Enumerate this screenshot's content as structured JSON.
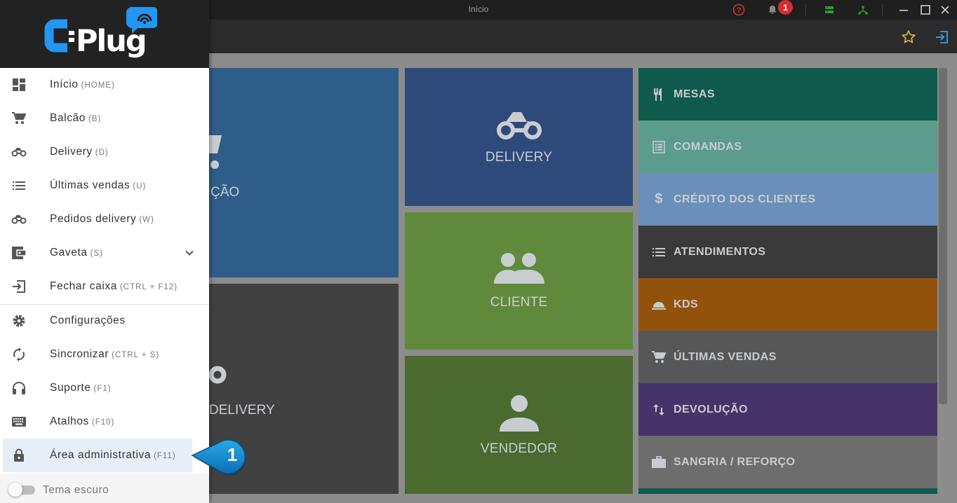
{
  "window": {
    "title": "Início",
    "notification_count": "1"
  },
  "tiles": {
    "balcao_partial": "ÇÃO",
    "delivery_partial": "DELIVERY",
    "delivery": "DELIVERY",
    "cliente": "CLIENTE",
    "vendedor": "VENDEDOR"
  },
  "side_menu": [
    {
      "label": "MESAS",
      "icon": "fork-knife-icon",
      "color": "#105a4d"
    },
    {
      "label": "COMANDAS",
      "icon": "list-box-icon",
      "color": "#5b9c8d"
    },
    {
      "label": "CRÉDITO DOS CLIENTES",
      "icon": "dollar-icon",
      "color": "#6890ba"
    },
    {
      "label": "ATENDIMENTOS",
      "icon": "list-icon",
      "color": "#3a3a3a"
    },
    {
      "label": "KDS",
      "icon": "cloche-icon",
      "color": "#92520c"
    },
    {
      "label": "ÚLTIMAS VENDAS",
      "icon": "cart-icon",
      "color": "#575757"
    },
    {
      "label": "DEVOLUÇÃO",
      "icon": "swap-vert-icon",
      "color": "#45336a"
    },
    {
      "label": "SANGRIA / REFORÇO",
      "icon": "briefcase-icon",
      "color": "#6d6d6d"
    }
  ],
  "logo": {
    "text": "CPlug"
  },
  "nav": [
    {
      "label": "Início",
      "key": "(HOME)",
      "icon": "dashboard-icon"
    },
    {
      "label": "Balcão",
      "key": "(B)",
      "icon": "cart-icon"
    },
    {
      "label": "Delivery",
      "key": "(D)",
      "icon": "motorbike-icon"
    },
    {
      "label": "Últimas vendas",
      "key": "(U)",
      "icon": "list-icon"
    },
    {
      "label": "Pedidos delivery",
      "key": "(W)",
      "icon": "motorbike-icon"
    },
    {
      "label": "Gaveta",
      "key": "(S)",
      "icon": "wallet-icon"
    },
    {
      "label": "Fechar caixa",
      "key": "(CTRL + F12)",
      "icon": "logout-icon"
    },
    {
      "label": "Configurações",
      "key": "",
      "icon": "gear-icon"
    },
    {
      "label": "Sincronizar",
      "key": "(CTRL + S)",
      "icon": "sync-icon"
    },
    {
      "label": "Suporte",
      "key": "(F1)",
      "icon": "headset-icon"
    },
    {
      "label": "Atalhos",
      "key": "(F10)",
      "icon": "keyboard-icon"
    },
    {
      "label": "Área administrativa",
      "key": "(F11)",
      "icon": "lock-icon"
    }
  ],
  "theme_toggle": {
    "label": "Tema escuro"
  },
  "callout": {
    "number": "1"
  }
}
